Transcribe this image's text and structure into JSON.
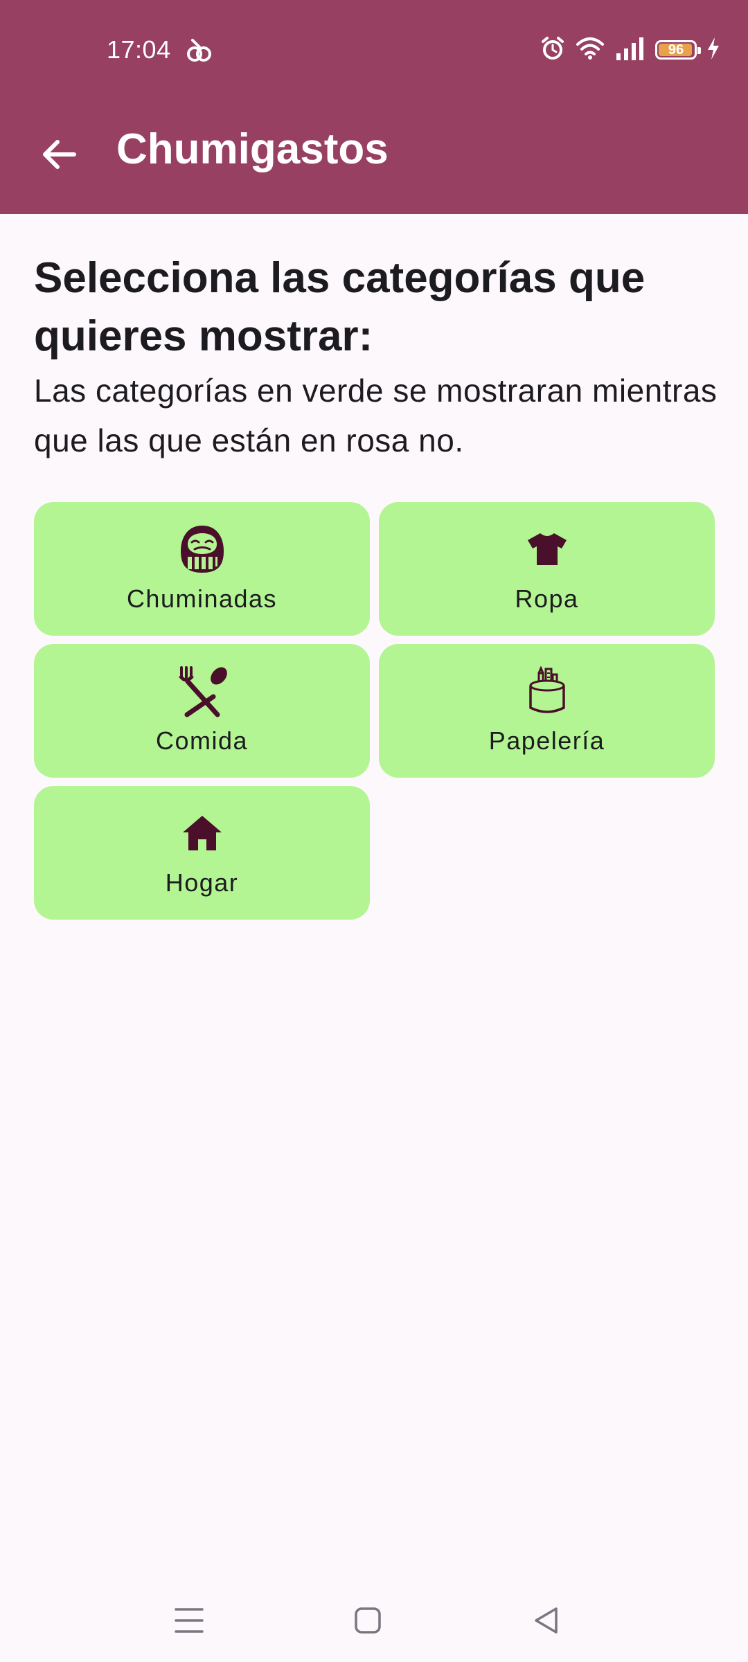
{
  "status_bar": {
    "time": "17:04",
    "battery_level": "96",
    "icons": [
      "notification-icon",
      "alarm-icon",
      "wifi-icon",
      "signal-icon",
      "battery-icon",
      "charging-icon"
    ]
  },
  "app_bar": {
    "title": "Chumigastos",
    "back_icon": "arrow-back-icon",
    "color": "#984061"
  },
  "main": {
    "heading": "Selecciona las categorías que quieres mostrar:",
    "description": "Las categorías en verde se mostraran mientras que las que están en rosa no."
  },
  "categories": [
    {
      "label": "Chuminadas",
      "icon": "daruma-icon",
      "state": "shown",
      "color": "#b3f592"
    },
    {
      "label": "Ropa",
      "icon": "tshirt-icon",
      "state": "shown",
      "color": "#b3f592"
    },
    {
      "label": "Comida",
      "icon": "fork-spoon-icon",
      "state": "shown",
      "color": "#b3f592"
    },
    {
      "label": "Papelería",
      "icon": "pencil-cup-icon",
      "state": "shown",
      "color": "#b3f592"
    },
    {
      "label": "Hogar",
      "icon": "house-icon",
      "state": "shown",
      "color": "#b3f592"
    }
  ],
  "nav_bar": {
    "icons": [
      "menu-icon",
      "home-square-icon",
      "back-triangle-icon"
    ]
  },
  "colors": {
    "shown": "#b3f592",
    "hidden": "pink",
    "icon": "#4a0f2a",
    "background": "#fdf8fc"
  }
}
